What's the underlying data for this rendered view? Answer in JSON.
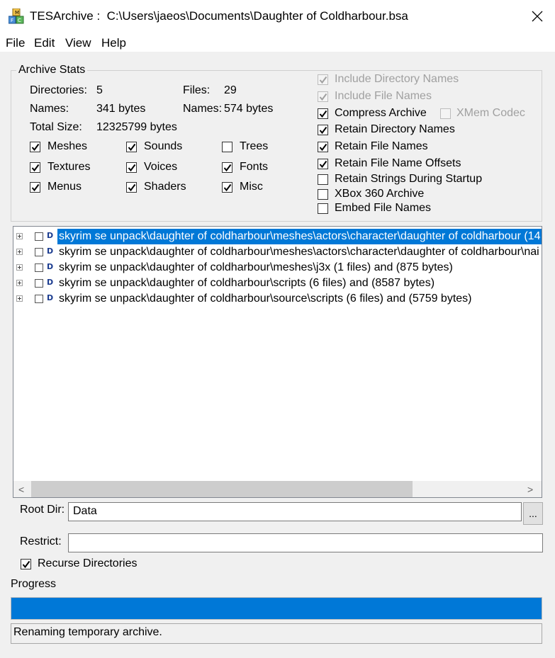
{
  "window": {
    "app_name": "TESArchive :",
    "file_path": "C:\\Users\\jaeos\\Documents\\Daughter of Coldharbour.bsa",
    "close_glyph": "✕"
  },
  "menu": [
    "File",
    "Edit",
    "View",
    "Help"
  ],
  "stats": {
    "group_title": "Archive Stats",
    "directories_label": "Directories:",
    "directories_value": "5",
    "files_label": "Files:",
    "files_value": "29",
    "names_label": "Names:",
    "names_value": "341 bytes",
    "names2_label": "Names:",
    "names2_value": "574 bytes",
    "total_label": "Total Size:",
    "total_value": "12325799 bytes"
  },
  "types": [
    {
      "label": "Meshes",
      "checked": true
    },
    {
      "label": "Sounds",
      "checked": true
    },
    {
      "label": "Trees",
      "checked": false
    },
    {
      "label": "Textures",
      "checked": true
    },
    {
      "label": "Voices",
      "checked": true
    },
    {
      "label": "Fonts",
      "checked": true
    },
    {
      "label": "Menus",
      "checked": true
    },
    {
      "label": "Shaders",
      "checked": true
    },
    {
      "label": "Misc",
      "checked": true
    }
  ],
  "options": [
    {
      "label": "Include Directory Names",
      "checked": true,
      "disabled": true
    },
    {
      "label": "Include File Names",
      "checked": true,
      "disabled": true
    },
    {
      "label": "Compress Archive",
      "checked": true,
      "disabled": false
    },
    {
      "label": "Retain Directory Names",
      "checked": true,
      "disabled": false
    },
    {
      "label": "Retain File Names",
      "checked": true,
      "disabled": false
    },
    {
      "label": "Retain File Name Offsets",
      "checked": true,
      "disabled": false
    },
    {
      "label": "Retain Strings During Startup",
      "checked": false,
      "disabled": false
    },
    {
      "label": "XBox 360 Archive",
      "checked": false,
      "disabled": false
    },
    {
      "label": "Embed File Names",
      "checked": false,
      "disabled": false
    }
  ],
  "xmem": {
    "label": "XMem Codec",
    "checked": false,
    "disabled": true
  },
  "tree": {
    "icon_glyph": "D",
    "rows": [
      {
        "text": "skyrim se unpack\\daughter of coldharbour\\meshes\\actors\\character\\daughter of coldharbour (14",
        "selected": true
      },
      {
        "text": "skyrim se unpack\\daughter of coldharbour\\meshes\\actors\\character\\daughter of coldharbour\\nai",
        "selected": false
      },
      {
        "text": "skyrim se unpack\\daughter of coldharbour\\meshes\\j3x (1 files) and (875 bytes)",
        "selected": false
      },
      {
        "text": "skyrim se unpack\\daughter of coldharbour\\scripts (6 files) and (8587 bytes)",
        "selected": false
      },
      {
        "text": "skyrim se unpack\\daughter of coldharbour\\source\\scripts (6 files) and (5759 bytes)",
        "selected": false
      }
    ]
  },
  "scroll": {
    "left_glyph": "<",
    "right_glyph": ">"
  },
  "root_dir": {
    "label": "Root Dir:",
    "value": "Data",
    "browse_label": "..."
  },
  "restrict": {
    "label": "Restrict:",
    "value": ""
  },
  "recurse": {
    "label": "Recurse Directories",
    "checked": true
  },
  "progress": {
    "label": "Progress",
    "fraction": 1.0,
    "color": "#0078d7"
  },
  "status": {
    "text": "Renaming temporary archive."
  },
  "colors": {
    "selection": "#0078d7"
  }
}
